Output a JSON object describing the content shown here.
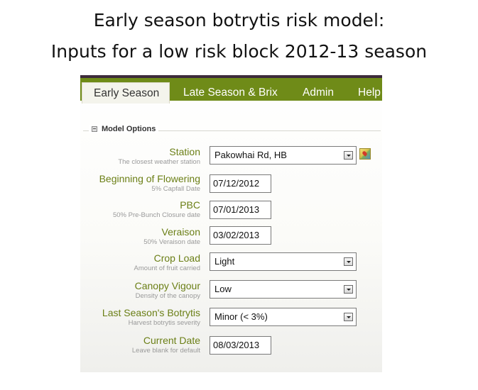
{
  "slide": {
    "title_line1": "Early season botrytis risk model:",
    "title_line2": "Inputs for a low risk block 2012-13 season"
  },
  "tabs": [
    {
      "label": "Early Season",
      "active": true
    },
    {
      "label": "Late Season & Brix",
      "active": false
    },
    {
      "label": "Admin",
      "active": false
    },
    {
      "label": "Help",
      "active": false
    }
  ],
  "model_options": {
    "legend": "Model Options",
    "fields": {
      "station": {
        "label": "Station",
        "hint": "The closest weather station",
        "value": "Pakowhai Rd, HB"
      },
      "flowering": {
        "label": "Beginning of Flowering",
        "hint": "5% Capfall Date",
        "value": "07/12/2012"
      },
      "pbc": {
        "label": "PBC",
        "hint": "50% Pre-Bunch Closure date",
        "value": "07/01/2013"
      },
      "veraison": {
        "label": "Veraison",
        "hint": "50% Veraison date",
        "value": "03/02/2013"
      },
      "crop_load": {
        "label": "Crop Load",
        "hint": "Amount of fruit carried",
        "value": "Light"
      },
      "canopy_vigour": {
        "label": "Canopy Vigour",
        "hint": "Density of the canopy",
        "value": "Low"
      },
      "last_botrytis": {
        "label": "Last Season's Botrytis",
        "hint": "Harvest botrytis severity",
        "value": "Minor (< 3%)"
      },
      "current_date": {
        "label": "Current Date",
        "hint": "Leave blank for default",
        "value": "08/03/2013"
      }
    }
  },
  "colors": {
    "tab_bar": "#6f8b18",
    "label_green": "#6b7f16",
    "hint_grey": "#9a9a9a"
  },
  "icons": {
    "map": "map-icon",
    "dropdown": "dropdown-arrow-icon",
    "collapse": "collapse-icon"
  }
}
